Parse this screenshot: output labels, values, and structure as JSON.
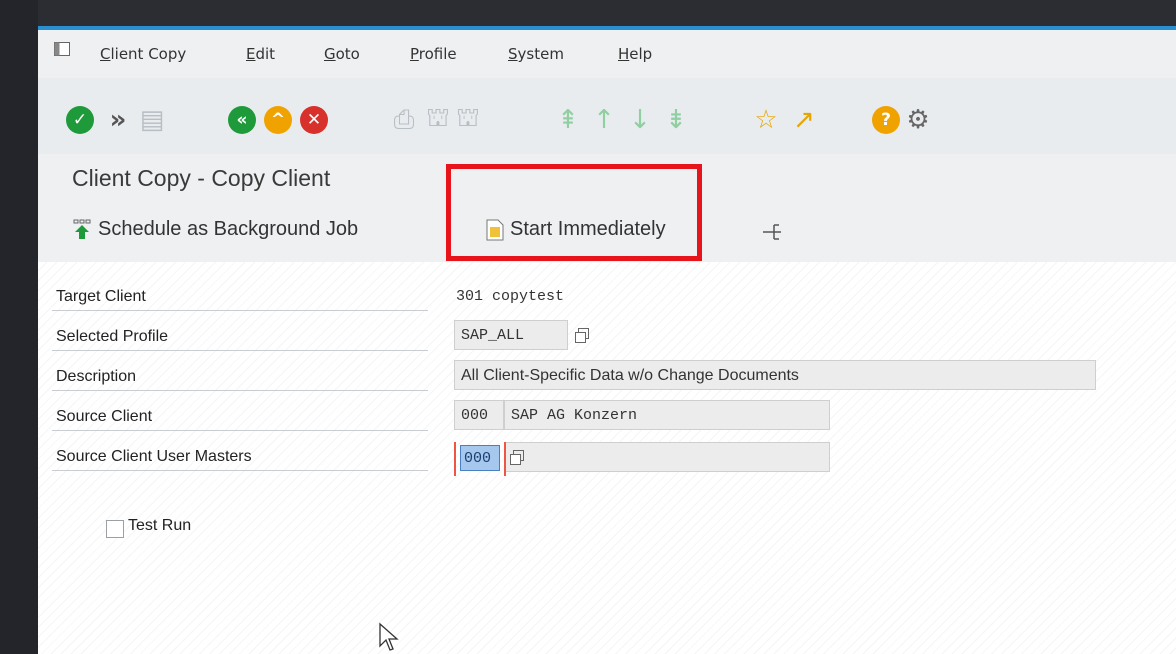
{
  "menubar": {
    "items": [
      "Client Copy",
      "Edit",
      "Goto",
      "Profile",
      "System",
      "Help"
    ]
  },
  "toolbar": {
    "icons": [
      "enter-check-icon",
      "fast-forward-icon",
      "save-icon",
      "back-icon",
      "exit-icon",
      "cancel-icon",
      "print-icon",
      "find-icon",
      "find-next-icon",
      "first-page-icon",
      "previous-page-icon",
      "next-page-icon",
      "last-page-icon",
      "create-session-icon",
      "shortcut-icon",
      "help-icon",
      "settings-icon"
    ]
  },
  "screen": {
    "title": "Client Copy - Copy Client"
  },
  "app_toolbar": {
    "schedule_label": "Schedule as Background Job",
    "start_label": "Start Immediately"
  },
  "form": {
    "target_client_label": "Target Client",
    "target_client_value": "301 copytest",
    "selected_profile_label": "Selected Profile",
    "selected_profile_value": "SAP_ALL",
    "description_label": "Description",
    "description_value": "All Client-Specific Data w/o Change Documents",
    "source_client_label": "Source Client",
    "source_client_value": "000",
    "source_client_name": "SAP AG Konzern",
    "source_user_masters_label": "Source Client User Masters",
    "source_user_masters_value": "000",
    "test_run_label": "Test Run",
    "test_run_checked": false
  },
  "colors": {
    "highlight": "#e8141b",
    "green": "#1f9a3b",
    "orange": "#f0a200",
    "red": "#d8302a",
    "frame_blue": "#2a8fd0"
  }
}
